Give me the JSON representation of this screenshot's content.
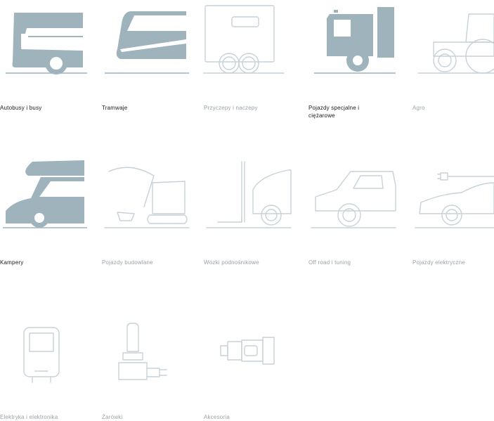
{
  "categories": [
    {
      "label": "Autobusy i busy",
      "icon": "bus-icon",
      "active": true
    },
    {
      "label": "Tramwaje",
      "icon": "tram-icon",
      "active": true
    },
    {
      "label": "Przyczepy i naczepy",
      "icon": "trailer-icon",
      "active": false
    },
    {
      "label": "Pojazdy specjalne i ciężarowe",
      "icon": "truck-icon",
      "active": true
    },
    {
      "label": "Agro",
      "icon": "tractor-icon",
      "active": false
    },
    {
      "label": "Kampery",
      "icon": "camper-icon",
      "active": true
    },
    {
      "label": "Pojazdy budowlane",
      "icon": "excavator-icon",
      "active": false
    },
    {
      "label": "Wózki podnośnikowe",
      "icon": "forklift-icon",
      "active": false
    },
    {
      "label": "Off road i tuning",
      "icon": "offroad-car-icon",
      "active": false
    },
    {
      "label": "Pojazdy elektryczne",
      "icon": "electric-car-icon",
      "active": false
    },
    {
      "label": "Elektryka i elektronika",
      "icon": "electronics-icon",
      "active": false
    },
    {
      "label": "Żarówki",
      "icon": "bulb-icon",
      "active": false
    },
    {
      "label": "Akcesoria",
      "icon": "accessories-icon",
      "active": false
    }
  ],
  "colors": {
    "active_icon": "#9fb3bd",
    "inactive_icon": "#c7d2d8",
    "active_text": "#1b1b1b",
    "inactive_text": "#9aa3a8"
  }
}
